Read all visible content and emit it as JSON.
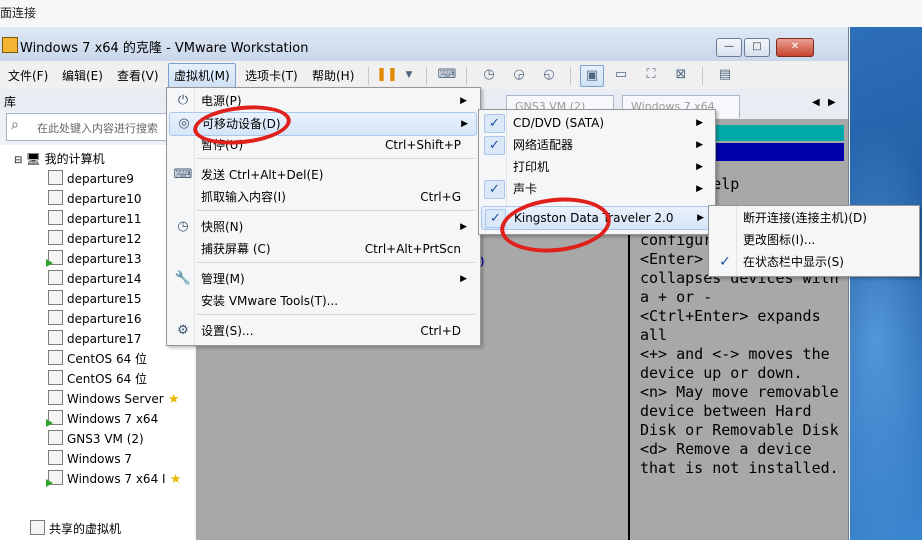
{
  "outer": {
    "strip_text": "面连接"
  },
  "window": {
    "title": "Windows 7 x64 的克隆 - VMware Workstation",
    "min_label": "—",
    "max_label": "□",
    "close_label": "✕"
  },
  "menubar": [
    {
      "label": "文件(F)"
    },
    {
      "label": "编辑(E)"
    },
    {
      "label": "查看(V)"
    },
    {
      "label": "虚拟机(M)"
    },
    {
      "label": "选项卡(T)"
    },
    {
      "label": "帮助(H)"
    }
  ],
  "library": {
    "title": "库",
    "search_placeholder": "在此处键入内容进行搜索",
    "root": "我的计算机",
    "vms": [
      "departure9",
      "departure10",
      "departure11",
      "departure12",
      "departure13",
      "departure14",
      "departure15",
      "departure16",
      "departure17",
      "CentOS 64 位",
      "CentOS 64 位",
      "Windows Server",
      "Windows 7 x64",
      "GNS3 VM (2)",
      "Windows 7",
      "Windows 7 x64 I"
    ],
    "shared": "共享的虚拟机"
  },
  "tabs": [
    {
      "label": "GNS3 VM (2)"
    },
    {
      "label": "Windows 7 x64"
    }
  ],
  "console": {
    "bios_header": "ecific Help",
    "bios_lines": [
      "Keys used to",
      "configure",
      "<Enter> expands or",
      "collapses devices with",
      "a + or -",
      "<Ctrl+Enter> expands",
      "all",
      "<+> and <-> moves the",
      "device up or down.",
      "<n> May move removable",
      "device between Hard",
      "Disk or Removable Disk",
      "<d> Remove a device",
      "that is not installed."
    ],
    "stray": "0"
  },
  "vm_menu": [
    {
      "icon": "power-icon",
      "label": "电源(P)",
      "shortcut": "",
      "submenu": true
    },
    {
      "icon": "disc-icon",
      "label": "可移动设备(D)",
      "shortcut": "",
      "submenu": true,
      "highlighted": true
    },
    {
      "icon": "",
      "label": "暂停(U)",
      "shortcut": "Ctrl+Shift+P",
      "submenu": false
    },
    {
      "icon": "keyboard-icon",
      "label": "发送 Ctrl+Alt+Del(E)",
      "shortcut": "",
      "submenu": false
    },
    {
      "icon": "",
      "label": "抓取输入内容(I)",
      "shortcut": "Ctrl+G",
      "submenu": false
    },
    {
      "icon": "snapshot-icon",
      "label": "快照(N)",
      "shortcut": "",
      "submenu": true
    },
    {
      "icon": "",
      "label": "捕获屏幕 (C)",
      "shortcut": "Ctrl+Alt+PrtScn",
      "submenu": false
    },
    {
      "icon": "wrench-icon",
      "label": "管理(M)",
      "shortcut": "",
      "submenu": true
    },
    {
      "icon": "",
      "label": "安装 VMware Tools(T)...",
      "shortcut": "",
      "submenu": false
    },
    {
      "icon": "settings-icon",
      "label": "设置(S)...",
      "shortcut": "Ctrl+D",
      "submenu": false
    }
  ],
  "devices_menu": [
    {
      "label": "CD/DVD (SATA)",
      "checked": true
    },
    {
      "label": "网络适配器",
      "checked": true
    },
    {
      "label": "打印机",
      "checked": false
    },
    {
      "label": "声卡",
      "checked": true
    },
    {
      "label": "Kingston Data Traveler 2.0",
      "checked": true,
      "highlighted": true
    }
  ],
  "usb_menu": [
    {
      "label": "断开连接(连接主机)(D)",
      "checked": false
    },
    {
      "label": "更改图标(I)...",
      "checked": false
    },
    {
      "label": "在状态栏中显示(S)",
      "checked": true
    }
  ],
  "glyphs": {
    "arrow": "▶",
    "check": "✓"
  },
  "colors": {
    "annotation_red": "#e0201a",
    "bios_cyan": "#00a8a8",
    "bios_blue": "#0000a8"
  }
}
